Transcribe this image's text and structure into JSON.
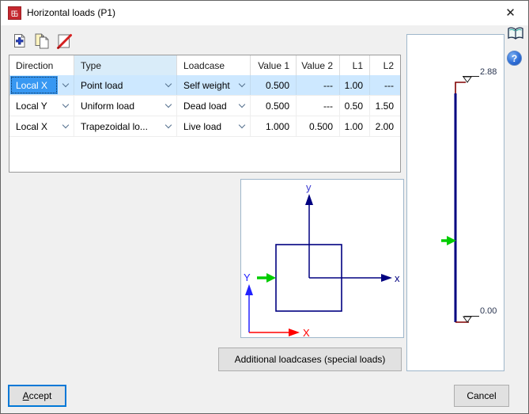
{
  "window": {
    "title": "Horizontal loads (P1)",
    "close_glyph": "✕"
  },
  "toolbar": {
    "add_icon": "add-load-row-icon",
    "copy_icon": "copy-load-row-icon",
    "delete_icon": "delete-load-row-icon"
  },
  "help": {
    "book_icon": "manual-book-icon",
    "help_glyph": "?"
  },
  "table": {
    "columns": [
      "Direction",
      "Type",
      "Loadcase",
      "Value 1",
      "Value 2",
      "L1",
      "L2"
    ],
    "rows": [
      {
        "direction": "Local X",
        "type": "Point load",
        "loadcase": "Self weight",
        "value1": "0.500",
        "value2": "---",
        "l1": "1.00",
        "l2": "---"
      },
      {
        "direction": "Local Y",
        "type": "Uniform load",
        "loadcase": "Dead load",
        "value1": "0.500",
        "value2": "---",
        "l1": "0.50",
        "l2": "1.50"
      },
      {
        "direction": "Local X",
        "type": "Trapezoidal lo...",
        "loadcase": "Live load",
        "value1": "1.000",
        "value2": "0.500",
        "l1": "1.00",
        "l2": "2.00"
      }
    ],
    "selected_row_index": 0,
    "highlighted_column": "Type"
  },
  "section_diagram": {
    "local_x_label": "x",
    "local_y_label": "y",
    "global_x_label": "X",
    "global_y_label": "Y"
  },
  "elevation_diagram": {
    "top_level": "2.88",
    "bottom_level": "0.00"
  },
  "buttons": {
    "additional": "Additional loadcases (special loads)",
    "accept_mnemonic": "A",
    "accept_rest": "ccept",
    "cancel": "Cancel"
  },
  "colors": {
    "selection_blue": "#3898f2",
    "selected_row_bg": "#cde8ff",
    "header_highlight_bg": "#d9ecf9",
    "member_navy": "#000080",
    "support_maroon": "#800000",
    "load_green": "#00cc00",
    "global_y_blue": "#2222ff",
    "global_x_red": "#ff0000",
    "default_button_focus": "#0078d7"
  }
}
